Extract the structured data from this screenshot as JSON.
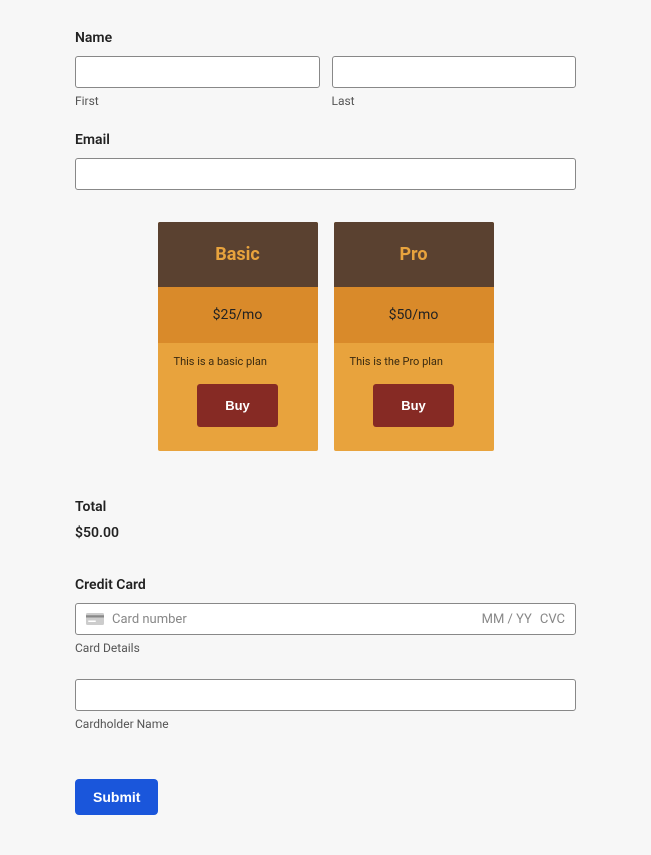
{
  "name": {
    "label": "Name",
    "first_sub": "First",
    "last_sub": "Last"
  },
  "email": {
    "label": "Email"
  },
  "plans": [
    {
      "title": "Basic",
      "price": "$25/mo",
      "desc": "This is a basic plan",
      "cta": "Buy"
    },
    {
      "title": "Pro",
      "price": "$50/mo",
      "desc": "This is the Pro plan",
      "cta": "Buy"
    }
  ],
  "total": {
    "label": "Total",
    "amount": "$50.00"
  },
  "cc": {
    "label": "Credit Card",
    "card_number_placeholder": "Card number",
    "expiry_placeholder": "MM / YY",
    "cvc_placeholder": "CVC",
    "details_sub": "Card Details",
    "holder_sub": "Cardholder Name"
  },
  "submit": {
    "label": "Submit"
  }
}
